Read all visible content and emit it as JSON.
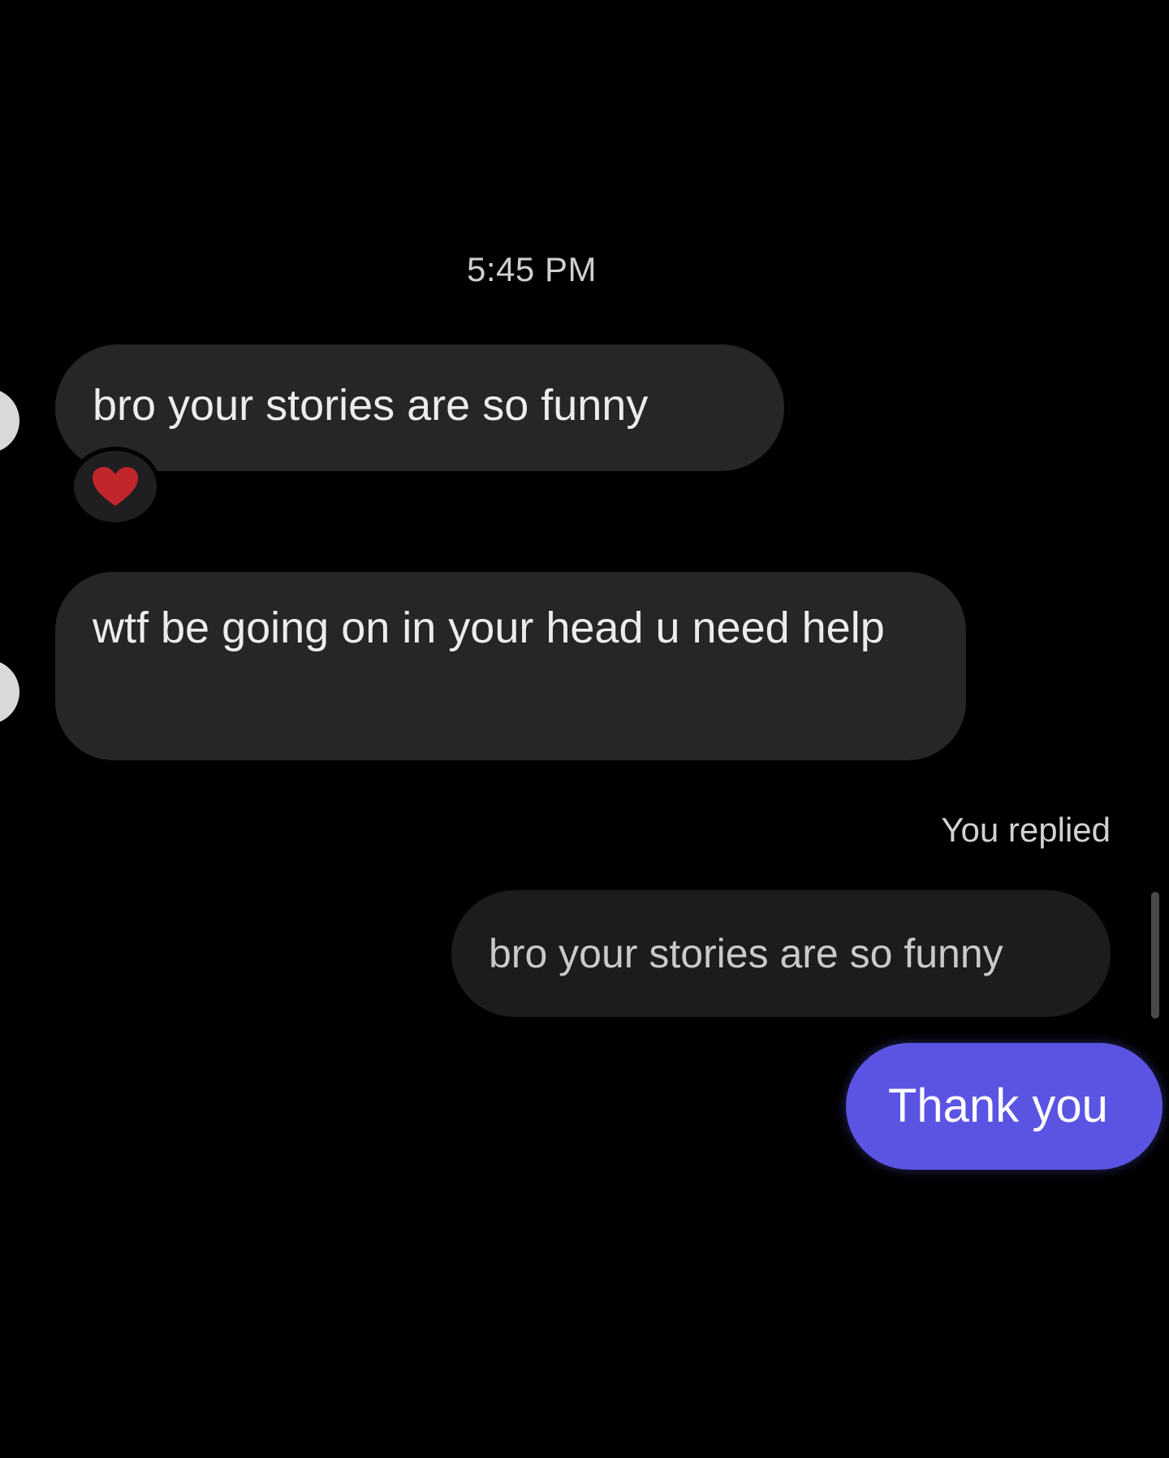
{
  "chat": {
    "timestamp": "5:45 PM",
    "messages": [
      {
        "direction": "incoming",
        "text": "bro your stories are so funny",
        "reaction": "heart-icon"
      },
      {
        "direction": "incoming",
        "text": "wtf be going on in your head u need help"
      }
    ],
    "reply": {
      "label": "You replied",
      "quoted_text": "bro your stories are so funny",
      "text": "Thank you"
    }
  },
  "colors": {
    "background": "#000000",
    "incoming_bubble": "#262527",
    "quoted_bubble": "#1c1b1d",
    "outgoing_bubble": "#5b54e3",
    "reaction_heart": "#c0262c"
  }
}
